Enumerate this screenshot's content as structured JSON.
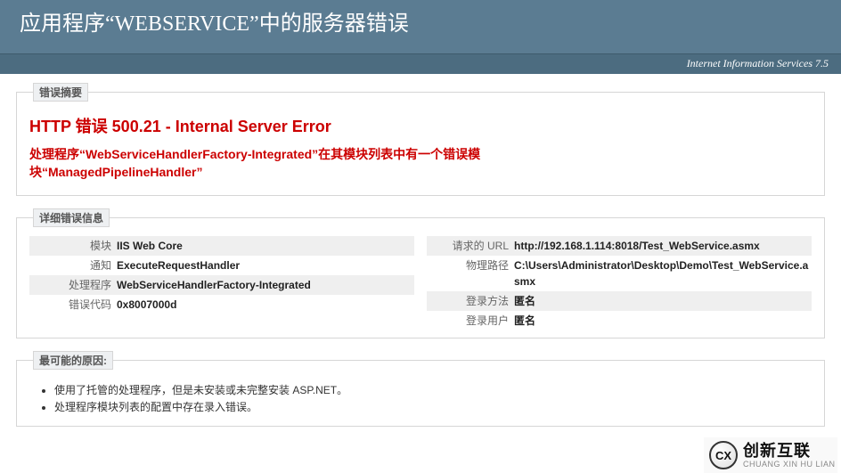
{
  "header": {
    "title": "应用程序“WEBSERVICE”中的服务器错误",
    "iis_strip": "Internet Information Services 7.5"
  },
  "summary": {
    "legend": "错误摘要",
    "title": "HTTP 错误 500.21 - Internal Server Error",
    "subtitle": "处理程序“WebServiceHandlerFactory-Integrated”在其模块列表中有一个错误模块“ManagedPipelineHandler”"
  },
  "details": {
    "legend": "详细错误信息",
    "left": [
      {
        "label": "模块",
        "value": "IIS Web Core",
        "alt": true
      },
      {
        "label": "通知",
        "value": "ExecuteRequestHandler",
        "alt": false
      },
      {
        "label": "处理程序",
        "value": "WebServiceHandlerFactory-Integrated",
        "alt": true
      },
      {
        "label": "错误代码",
        "value": "0x8007000d",
        "alt": false
      }
    ],
    "right": [
      {
        "label": "请求的 URL",
        "value": "http://192.168.1.114:8018/Test_WebService.asmx",
        "alt": true
      },
      {
        "label": "物理路径",
        "value": "C:\\Users\\Administrator\\Desktop\\Demo\\Test_WebService.asmx",
        "alt": false
      },
      {
        "label": "登录方法",
        "value": "匿名",
        "alt": true
      },
      {
        "label": "登录用户",
        "value": "匿名",
        "alt": false
      }
    ]
  },
  "causes": {
    "legend": "最可能的原因:",
    "items": [
      "使用了托管的处理程序，但是未安装或未完整安装 ASP.NET。",
      "处理程序模块列表的配置中存在录入错误。"
    ]
  },
  "brand": {
    "mark": "CX",
    "cn": "创新互联",
    "py": "CHUANG XIN HU LIAN"
  }
}
